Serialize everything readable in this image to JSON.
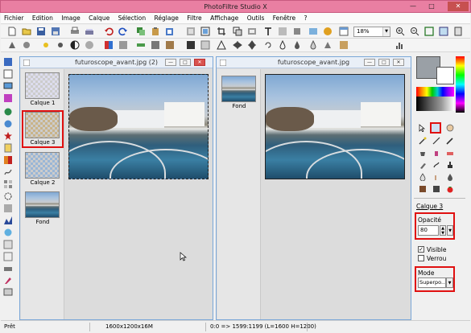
{
  "window": {
    "title": "PhotoFiltre Studio X",
    "minimize": "—",
    "maximize": "□",
    "close": "✕"
  },
  "menu": [
    "Fichier",
    "Edition",
    "Image",
    "Calque",
    "Sélection",
    "Réglage",
    "Filtre",
    "Affichage",
    "Outils",
    "Fenêtre",
    "?"
  ],
  "toolbar": {
    "zoom": "18%"
  },
  "doc1": {
    "title": "futuroscope_avant.jpg (2)",
    "layers": [
      "Calque 1",
      "Calque 3",
      "Calque 2",
      "Fond"
    ]
  },
  "doc2": {
    "title": "futuroscope_avant.jpg",
    "layers": [
      "Fond"
    ]
  },
  "panel": {
    "layer_name": "Calque 3",
    "opacity_label": "Opacité",
    "opacity_value": "80",
    "visible_label": "Visible",
    "lock_label": "Verrou",
    "mode_label": "Mode",
    "mode_value": "Superpo..."
  },
  "status": {
    "state": "Prêt",
    "size": "1600x1200x16M",
    "coords": "0:0 => 1599:1199 (L=1600  H=1200)"
  },
  "colors": {
    "titlebar": "#e97fa2",
    "highlight": "#e01010"
  }
}
